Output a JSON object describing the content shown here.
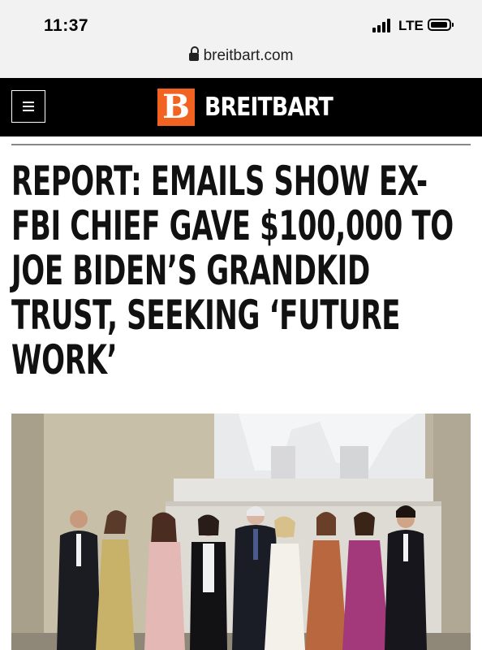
{
  "status_bar": {
    "time": "11:37",
    "network": "LTE"
  },
  "browser": {
    "url": "breitbart.com"
  },
  "header": {
    "logo_mark": "B",
    "logo_text": "BREITBART"
  },
  "article": {
    "headline": "REPORT: EMAILS SHOW EX-FBI CHIEF GAVE $100,000 TO JOE BIDEN’S GRANDKID TRUST, SEEKING ‘FUTURE WORK’"
  },
  "icons": [
    "signal-icon",
    "battery-icon",
    "lock-icon",
    "menu-icon"
  ],
  "colors": {
    "brand": "#f26322",
    "header_bg": "#000000",
    "chrome_bg": "#f2f2f2"
  }
}
